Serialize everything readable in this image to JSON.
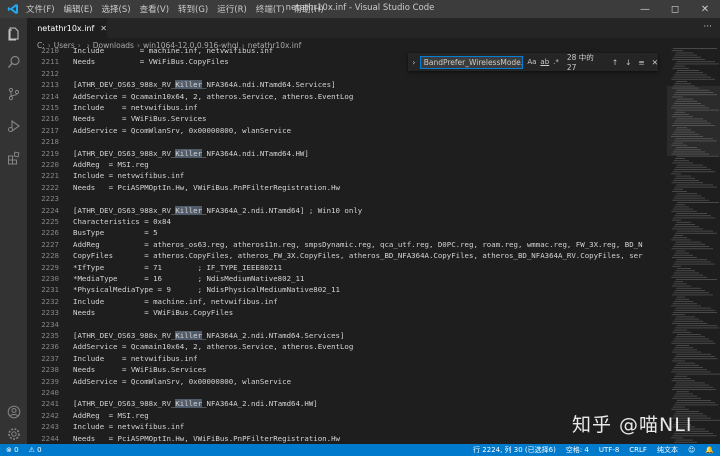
{
  "titlebar": {
    "menus": [
      "文件(F)",
      "编辑(E)",
      "选择(S)",
      "查看(V)",
      "转到(G)",
      "运行(R)",
      "终端(T)",
      "帮助(H)"
    ],
    "title": "netathr10x.inf - Visual Studio Code"
  },
  "tab": {
    "label": "netathr10x.inf"
  },
  "breadcrumb": [
    "C:",
    "Users",
    "",
    "Downloads",
    "win1064-12.0.0.916-whql",
    "netathr10x.inf"
  ],
  "find": {
    "query": "BandPrefer_WirelessMode.n",
    "options": [
      "Aa",
      "ab",
      ".*"
    ],
    "count": "28 中的 27"
  },
  "editor": {
    "lines": [
      {
        "n": "2210",
        "t": "Include        = machine.inf, netvwifibus.inf"
      },
      {
        "n": "2211",
        "t": "Needs          = VWiFiBus.CopyFiles"
      },
      {
        "n": "2212",
        "t": ""
      },
      {
        "n": "2213",
        "t": "[ATHR_DEV_OS63_988x_RV_Killer_NFA364A.ndi.NTamd64.Services]"
      },
      {
        "n": "2214",
        "t": "AddService = Qcamain10x64, 2, atheros.Service, atheros.EventLog"
      },
      {
        "n": "2215",
        "t": "Include    = netvwifibus.inf"
      },
      {
        "n": "2216",
        "t": "Needs      = VWiFiBus.Services"
      },
      {
        "n": "2217",
        "t": "AddService = QcomWlanSrv, 0x00000800, wlanService"
      },
      {
        "n": "2218",
        "t": ""
      },
      {
        "n": "2219",
        "t": "[ATHR_DEV_OS63_988x_RV_Killer_NFA364A.ndi.NTamd64.HW]"
      },
      {
        "n": "2220",
        "t": "AddReg  = MSI.reg"
      },
      {
        "n": "2221",
        "t": "Include = netvwifibus.inf"
      },
      {
        "n": "2222",
        "t": "Needs   = PciASPMOptIn.Hw, VWiFiBus.PnPFilterRegistration.Hw"
      },
      {
        "n": "2223",
        "t": ""
      },
      {
        "n": "2224",
        "t": "[ATHR_DEV_OS63_988x_RV_Killer_NFA364A_2.ndi.NTamd64] ; Win10 only"
      },
      {
        "n": "2225",
        "t": "Characteristics = 0x84"
      },
      {
        "n": "2226",
        "t": "BusType         = 5"
      },
      {
        "n": "2227",
        "t": "AddReg          = atheros_os63.reg, atheros11n.reg, smpsDynamic.reg, qca_utf.reg, D0PC.reg, roam.reg, wmmac.reg, FW_3X.reg, BD_N"
      },
      {
        "n": "2228",
        "t": "CopyFiles       = atheros.CopyFiles, atheros_FW_3X.CopyFiles, atheros_BD_NFA364A.CopyFiles, atheros_BD_NFA364A_RV.CopyFiles, ser"
      },
      {
        "n": "2229",
        "t": "*IfType         = 71        ; IF_TYPE_IEEE80211"
      },
      {
        "n": "2230",
        "t": "*MediaType      = 16        ; NdisMediumNative802_11"
      },
      {
        "n": "2231",
        "t": "*PhysicalMediaType = 9      ; NdisPhysicalMediumNative802_11"
      },
      {
        "n": "2232",
        "t": "Include         = machine.inf, netvwifibus.inf"
      },
      {
        "n": "2233",
        "t": "Needs           = VWiFiBus.CopyFiles"
      },
      {
        "n": "2234",
        "t": ""
      },
      {
        "n": "2235",
        "t": "[ATHR_DEV_OS63_988x_RV_Killer_NFA364A_2.ndi.NTamd64.Services]"
      },
      {
        "n": "2236",
        "t": "AddService = Qcamain10x64, 2, atheros.Service, atheros.EventLog"
      },
      {
        "n": "2237",
        "t": "Include    = netvwifibus.inf"
      },
      {
        "n": "2238",
        "t": "Needs      = VWiFiBus.Services"
      },
      {
        "n": "2239",
        "t": "AddService = QcomWlanSrv, 0x00000800, wlanService"
      },
      {
        "n": "2240",
        "t": ""
      },
      {
        "n": "2241",
        "t": "[ATHR_DEV_OS63_988x_RV_Killer_NFA364A_2.ndi.NTamd64.HW]"
      },
      {
        "n": "2242",
        "t": "AddReg  = MSI.reg"
      },
      {
        "n": "2243",
        "t": "Include = netvwifibus.inf"
      },
      {
        "n": "2244",
        "t": "Needs   = PciASPMOptIn.Hw, VWiFiBus.PnPFilterRegistration.Hw"
      }
    ],
    "highlight": "Killer"
  },
  "statusbar": {
    "errors": "0",
    "warnings": "0",
    "position": "行 2224, 列 30 (已选择6)",
    "spaces": "空格: 4",
    "encoding": "UTF-8",
    "eol": "CRLF",
    "language": "纯文本"
  },
  "watermark": "知乎 @喵NLI",
  "colors": {
    "accent": "#007acc",
    "highlight": "#515c6a",
    "find_border": "#007fd4"
  }
}
